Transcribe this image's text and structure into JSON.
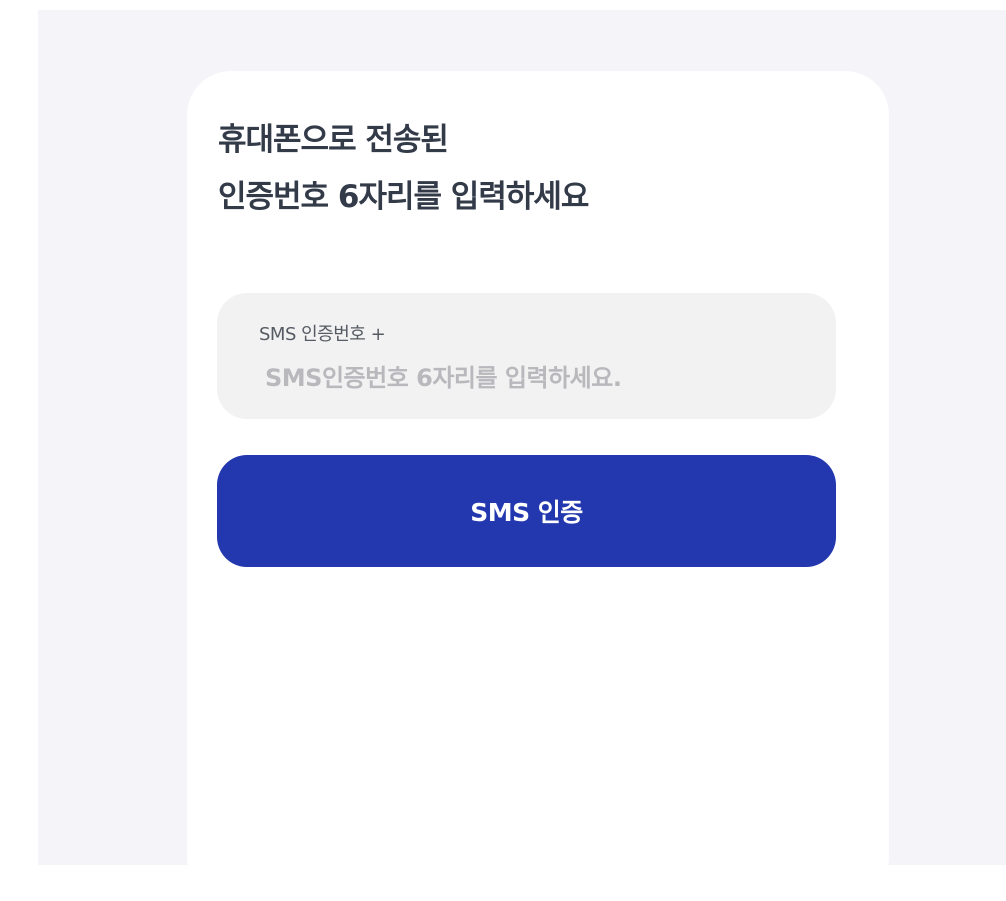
{
  "heading": {
    "line1": "휴대폰으로 전송된",
    "line2": "인증번호 6자리를 입력하세요"
  },
  "sms_input": {
    "label": "SMS 인증번호 +",
    "value": "",
    "placeholder": "SMS인증번호 6자리를 입력하세요."
  },
  "submit": {
    "label": "SMS 인증"
  },
  "colors": {
    "page_background": "#f4f4f9",
    "card_background": "#ffffff",
    "heading_text": "#333b49",
    "input_background": "#f2f2f2",
    "placeholder_text": "#b8b8bd",
    "button_background": "#2338ae",
    "button_text": "#ffffff"
  }
}
